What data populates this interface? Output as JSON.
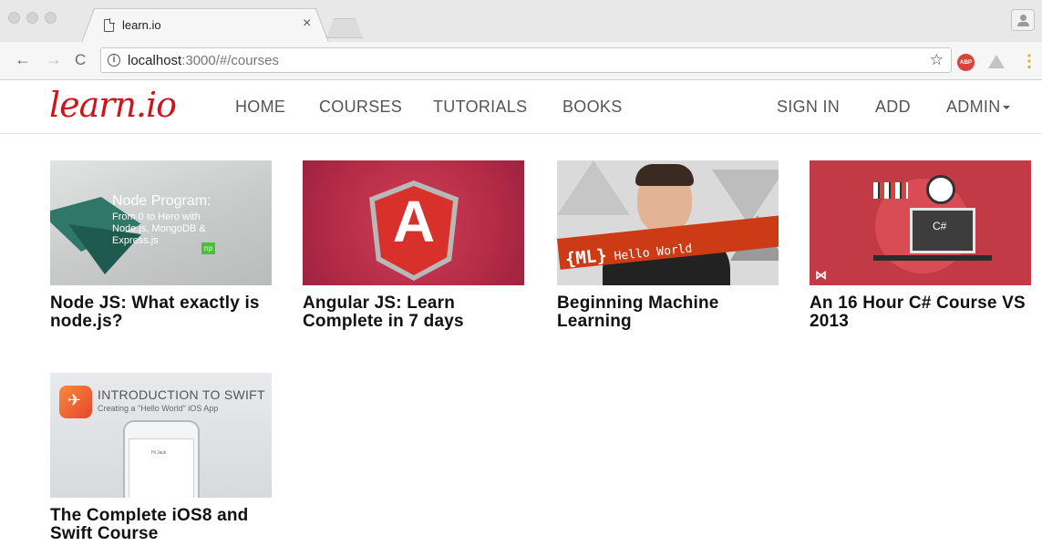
{
  "browser": {
    "tab_title": "learn.io",
    "tab_close": "×",
    "url_host": "localhost",
    "url_rest": ":3000/#/courses",
    "info_glyph": "i",
    "abp_label": "ABP",
    "star_glyph": "☆",
    "menu_glyph": "⋮",
    "back_glyph": "←",
    "forward_glyph": "→",
    "reload_glyph": "C"
  },
  "site": {
    "logo": "learn.io",
    "nav": {
      "home": "HOME",
      "courses": "COURSES",
      "tutorials": "TUTORIALS",
      "books": "BOOKS",
      "sign_in": "SIGN IN",
      "add": "ADD",
      "admin": "ADMIN"
    }
  },
  "courses": [
    {
      "title": "Node JS: What exactly is node.js?",
      "thumb_title": "Node Program:",
      "thumb_sub": "From 0 to Hero with Node.js, MongoDB & Express.js",
      "thumb_badge": "np"
    },
    {
      "title": "Angular JS: Learn Complete in 7 days",
      "thumb_glyph": "A"
    },
    {
      "title": "Beginning Machine Learning",
      "thumb_tag": "{ML}",
      "thumb_text": "Hello World"
    },
    {
      "title": "An 16 Hour C# Course VS 2013",
      "thumb_screen": "C#",
      "thumb_logo": "⋈"
    },
    {
      "title": "The Complete iOS8 and Swift Course",
      "thumb_title": "INTRODUCTION TO SWIFT",
      "thumb_sub": "Creating a \"Hello World\" iOS App",
      "thumb_screen": "Hi Jack"
    }
  ],
  "colors": {
    "logo": "#d0141d",
    "nav_text": "#555555",
    "title_text": "#111111"
  }
}
